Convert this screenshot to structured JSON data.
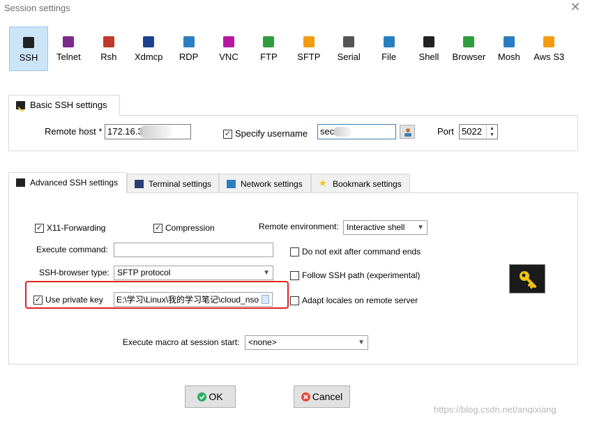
{
  "window": {
    "title": "Session settings",
    "close_glyph": "✕"
  },
  "protocols": [
    {
      "label": "SSH",
      "icon": "ssh-icon",
      "color": "#222222",
      "selected": true
    },
    {
      "label": "Telnet",
      "icon": "telnet-icon",
      "color": "#7b2a8a"
    },
    {
      "label": "Rsh",
      "icon": "rsh-icon",
      "color": "#c0392b"
    },
    {
      "label": "Xdmcp",
      "icon": "xdmcp-icon",
      "color": "#1f3f8f"
    },
    {
      "label": "RDP",
      "icon": "rdp-icon",
      "color": "#2a7fc1"
    },
    {
      "label": "VNC",
      "icon": "vnc-icon",
      "color": "#b5179e"
    },
    {
      "label": "FTP",
      "icon": "ftp-icon",
      "color": "#2e9e3e"
    },
    {
      "label": "SFTP",
      "icon": "sftp-icon",
      "color": "#f39c12"
    },
    {
      "label": "Serial",
      "icon": "serial-icon",
      "color": "#555555"
    },
    {
      "label": "File",
      "icon": "file-icon",
      "color": "#2a7fc1"
    },
    {
      "label": "Shell",
      "icon": "shell-icon",
      "color": "#222222"
    },
    {
      "label": "Browser",
      "icon": "browser-icon",
      "color": "#2e9e3e"
    },
    {
      "label": "Mosh",
      "icon": "mosh-icon",
      "color": "#2a7fc1"
    },
    {
      "label": "Aws S3",
      "icon": "aws-s3-icon",
      "color": "#f39c12"
    }
  ],
  "basic": {
    "tab_label": "Basic SSH settings",
    "remote_host_label": "Remote host *",
    "remote_host_value": "172.16.3",
    "specify_username_label": "Specify username",
    "specify_username_checked": true,
    "username_value": "sec",
    "port_label": "Port",
    "port_value": "5022"
  },
  "tabs": [
    {
      "label": "Advanced SSH settings",
      "icon": "advanced-ssh-icon",
      "active": true
    },
    {
      "label": "Terminal settings",
      "icon": "terminal-icon"
    },
    {
      "label": "Network settings",
      "icon": "network-icon"
    },
    {
      "label": "Bookmark settings",
      "icon": "star-icon"
    }
  ],
  "advanced": {
    "x11_label": "X11-Forwarding",
    "compression_label": "Compression",
    "remote_env_label": "Remote environment:",
    "remote_env_value": "Interactive shell",
    "execute_command_label": "Execute command:",
    "execute_command_value": "",
    "do_not_exit_label": "Do not exit after command ends",
    "ssh_browser_label": "SSH-browser type:",
    "ssh_browser_value": "SFTP protocol",
    "follow_ssh_label": "Follow SSH path (experimental)",
    "use_private_key_label": "Use private key",
    "private_key_value": "E:\\学习\\Linux\\我的学习笔记\\cloud_nso",
    "adapt_locales_label": "Adapt locales on remote server",
    "macro_label": "Execute macro at session start:",
    "macro_value": "<none>"
  },
  "buttons": {
    "ok": "OK",
    "cancel": "Cancel"
  },
  "watermark": "https://blog.csdn.net/anqixiang",
  "colors": {
    "highlight_box": "#e02020",
    "selected_bg": "#cce4f7",
    "key_bg": "#1b1b1b",
    "key_fg": "#f1c40f"
  }
}
